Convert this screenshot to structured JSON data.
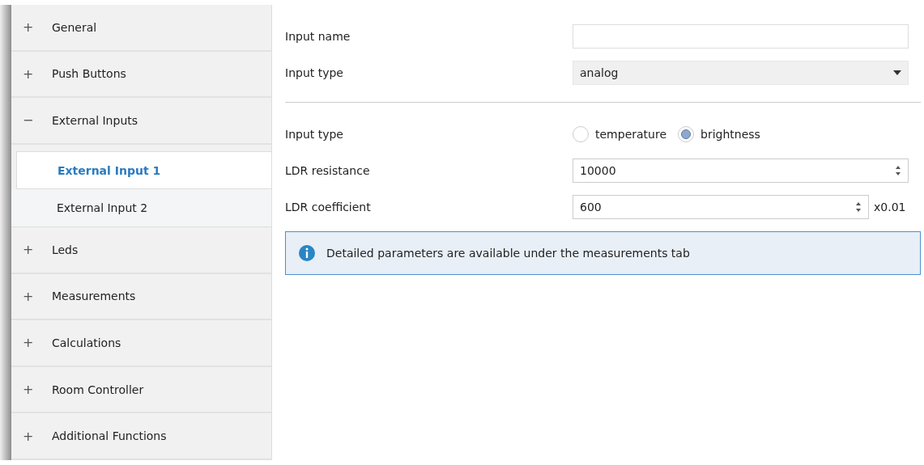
{
  "sidebar": {
    "items": [
      {
        "marker": "+",
        "label": "General",
        "expanded": false
      },
      {
        "marker": "+",
        "label": "Push Buttons",
        "expanded": false
      },
      {
        "marker": "−",
        "label": "External Inputs",
        "expanded": true,
        "children": [
          {
            "label": "External Input 1",
            "selected": true
          },
          {
            "label": "External Input 2",
            "selected": false
          }
        ]
      },
      {
        "marker": "+",
        "label": "Leds",
        "expanded": false
      },
      {
        "marker": "+",
        "label": "Measurements",
        "expanded": false
      },
      {
        "marker": "+",
        "label": "Calculations",
        "expanded": false
      },
      {
        "marker": "+",
        "label": "Room Controller",
        "expanded": false
      },
      {
        "marker": "+",
        "label": "Additional Functions",
        "expanded": false
      }
    ]
  },
  "form": {
    "rows": [
      {
        "kind": "text",
        "label": "Input name"
      },
      {
        "kind": "select",
        "label": "Input type",
        "value": "analog"
      },
      {
        "kind": "divider"
      },
      {
        "kind": "radio",
        "label": "Input type",
        "options": [
          {
            "label": "temperature",
            "selected": false
          },
          {
            "label": "brightness",
            "selected": true
          }
        ]
      },
      {
        "kind": "spin",
        "label": "LDR resistance",
        "value": "10000"
      },
      {
        "kind": "spin",
        "label": "LDR coefficient",
        "value": "600",
        "unit": "x0.01"
      }
    ],
    "info": "Detailed parameters are available under the measurements tab"
  }
}
